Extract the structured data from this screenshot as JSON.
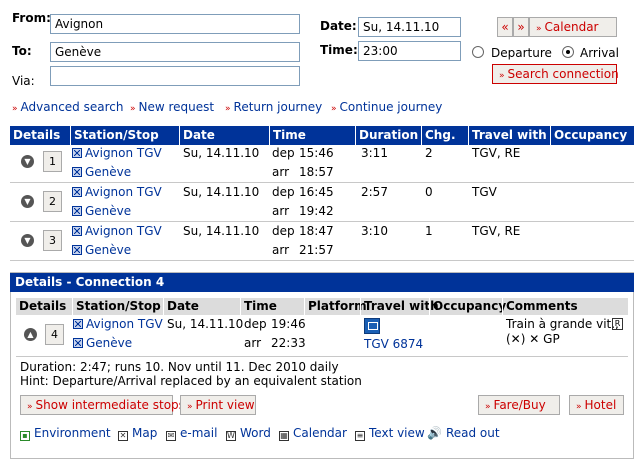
{
  "form": {
    "from_label": "From:",
    "from_value": "Avignon",
    "to_label": "To:",
    "to_value": "Genève",
    "via_label": "Via:",
    "via_value": "",
    "date_label": "Date:",
    "date_value": "Su, 14.11.10",
    "time_label": "Time:",
    "time_value": "23:00",
    "prev_day": "«",
    "next_day": "»",
    "calendar_button": "Calendar",
    "departure_label": "Departure",
    "arrival_label": "Arrival",
    "selected_mode": "arrival",
    "search_button": "Search connection"
  },
  "links": [
    "Advanced search",
    "New request",
    "Return journey",
    "Continue journey"
  ],
  "results": {
    "headers": [
      "Details",
      "Station/Stop",
      "Date",
      "Time",
      "Duration",
      "Chg.",
      "Travel with",
      "Occupancy"
    ],
    "rows": [
      {
        "num": "1",
        "from": "Avignon TGV",
        "to": "Genève",
        "date": "Su, 14.11.10",
        "dep_label": "dep",
        "dep": "15:46",
        "arr_label": "arr",
        "arr": "18:57",
        "duration": "3:11",
        "changes": "2",
        "travel": "TGV, RE"
      },
      {
        "num": "2",
        "from": "Avignon TGV",
        "to": "Genève",
        "date": "Su, 14.11.10",
        "dep_label": "dep",
        "dep": "16:45",
        "arr_label": "arr",
        "arr": "19:42",
        "duration": "2:57",
        "changes": "0",
        "travel": "TGV"
      },
      {
        "num": "3",
        "from": "Avignon TGV",
        "to": "Genève",
        "date": "Su, 14.11.10",
        "dep_label": "dep",
        "dep": "18:47",
        "arr_label": "arr",
        "arr": "21:57",
        "duration": "3:10",
        "changes": "1",
        "travel": "TGV, RE"
      }
    ]
  },
  "details": {
    "title": "Details - Connection 4",
    "headers": [
      "Details",
      "Station/Stop",
      "Date",
      "Time",
      "Platform",
      "Travel with",
      "Occupancy",
      "Comments"
    ],
    "row": {
      "num": "4",
      "from": "Avignon TGV",
      "to": "Genève",
      "date": "Su, 14.11.10",
      "dep_label": "dep",
      "dep": "19:46",
      "arr_label": "arr",
      "arr": "22:33",
      "train": "TGV 6874",
      "comment": "Train à grande vit.,",
      "comment2": "GP"
    },
    "duration_line": "Duration: 2:47; runs 10. Nov until 11. Dec 2010 daily",
    "hint_line": "Hint: Departure/Arrival replaced by an equivalent station",
    "buttons": {
      "intermediate": "Show intermediate stops",
      "print": "Print view",
      "fare": "Fare/Buy",
      "hotel": "Hotel"
    },
    "tools": [
      "Environment",
      "Map",
      "e-mail",
      "Word",
      "Calendar",
      "Text view",
      "Read out"
    ]
  },
  "colors": {
    "header_blue": "#003399",
    "link_red": "#cc0000"
  }
}
